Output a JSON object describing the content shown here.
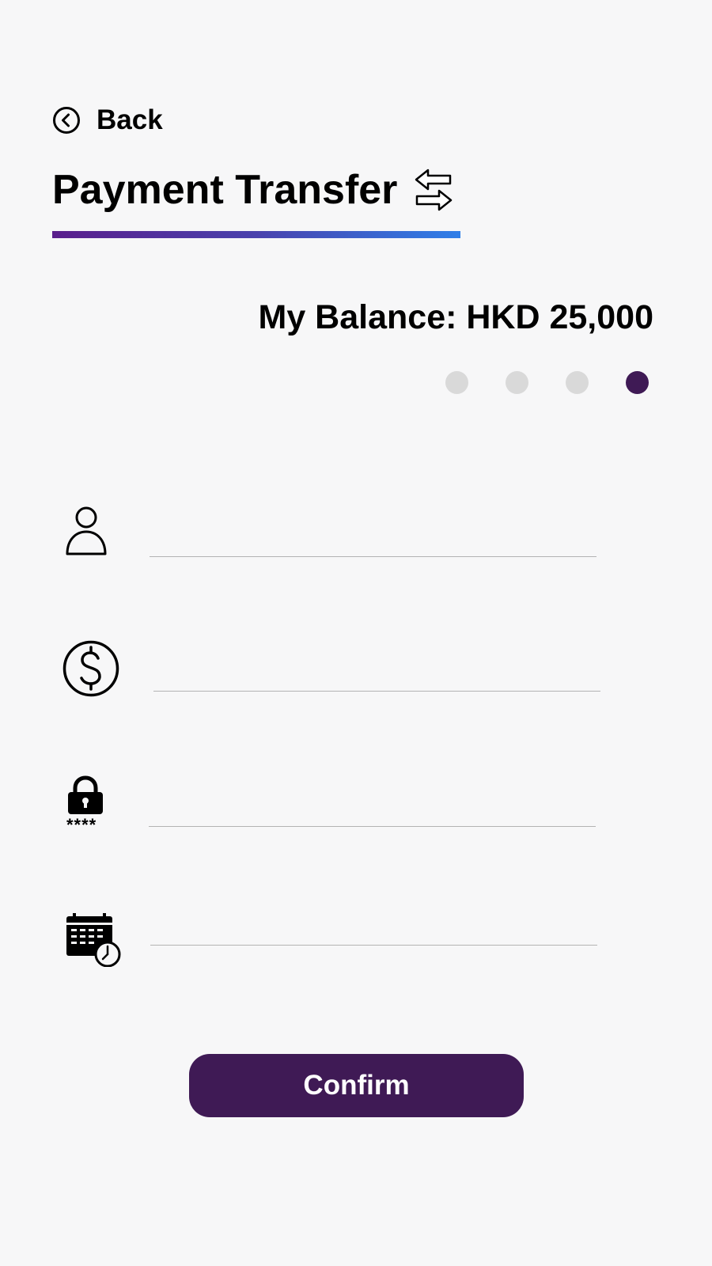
{
  "nav": {
    "back_label": "Back",
    "back_icon": "chevron-left-circle-icon"
  },
  "header": {
    "title": "Payment Transfer",
    "title_icon": "transfer-arrows-icon"
  },
  "balance": {
    "text": "My Balance: HKD 25,000"
  },
  "steps": {
    "total": 4,
    "current": 4
  },
  "form": {
    "fields": [
      {
        "icon": "person-icon",
        "value": ""
      },
      {
        "icon": "dollar-icon",
        "value": ""
      },
      {
        "icon": "lock-pin-icon",
        "value": "",
        "pin_mask": "****"
      },
      {
        "icon": "calendar-clock-icon",
        "value": ""
      }
    ]
  },
  "actions": {
    "confirm_label": "Confirm"
  },
  "colors": {
    "background": "#f7f7f8",
    "primary": "#3f1a55",
    "gradient_start": "#5a1f8c",
    "gradient_end": "#2f7fe8",
    "dot_inactive": "#d9d9d9",
    "line": "#b3b3b3"
  }
}
